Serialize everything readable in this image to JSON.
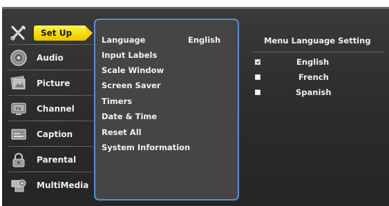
{
  "categories": [
    {
      "label": "Set Up",
      "icon": "tools-icon",
      "selected": true
    },
    {
      "label": "Audio",
      "icon": "speaker-icon"
    },
    {
      "label": "Picture",
      "icon": "picture-icon"
    },
    {
      "label": "Channel",
      "icon": "tv-icon"
    },
    {
      "label": "Caption",
      "icon": "caption-icon"
    },
    {
      "label": "Parental",
      "icon": "lock-icon"
    },
    {
      "label": "MultiMedia",
      "icon": "multimedia-icon"
    }
  ],
  "submenu": {
    "items": [
      "Language",
      "Input Labels",
      "Scale Window",
      "Screen Saver",
      "Timers",
      "Date & Time",
      "Reset All",
      "System Information"
    ],
    "language_value": "English"
  },
  "language_panel": {
    "title": "Menu Language Setting",
    "options": [
      {
        "label": "English",
        "checked": true
      },
      {
        "label": "French",
        "checked": false
      },
      {
        "label": "Spanish",
        "checked": false
      }
    ]
  },
  "colors": {
    "highlight": "#f5d800",
    "panel_border": "#5d8fd6",
    "background": "#2b2b2b"
  }
}
